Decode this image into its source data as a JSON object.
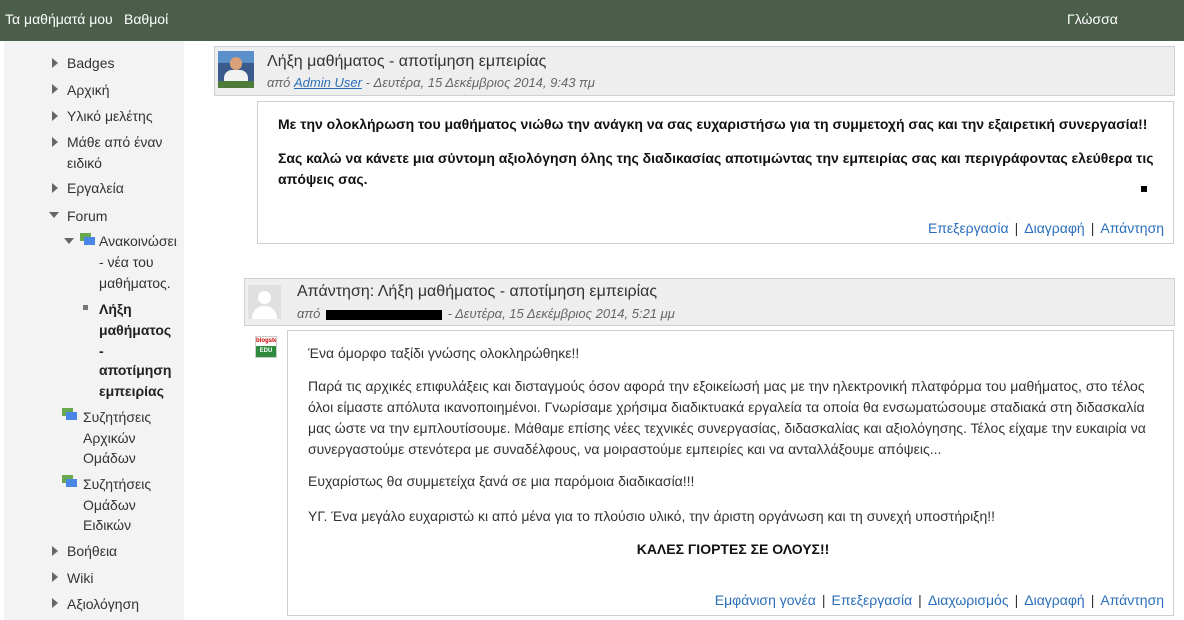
{
  "topbar": {
    "my_courses": "Τα μαθήματά μου",
    "grades": "Βαθμοί",
    "language": "Γλώσσα"
  },
  "sidebar": {
    "badges": "Badges",
    "home": "Αρχική",
    "material": "Υλικό μελέτης",
    "expert_line1": "Μάθε από έναν",
    "expert_line2": "ειδικό",
    "tools": "Εργαλεία",
    "forum": "Forum",
    "announcements_line1": "Ανακοινώσει",
    "announcements_line2": "- νέα του",
    "announcements_line3": "μαθήματος.",
    "current_line1": "Λήξη",
    "current_line2": "μαθήματος",
    "current_line3": "-",
    "current_line4": "αποτίμηση",
    "current_line5": "εμπειρίας",
    "initial_groups_line1": "Συζητήσεις",
    "initial_groups_line2": "Αρχικών",
    "initial_groups_line3": "Ομάδων",
    "special_groups_line1": "Συζητήσεις",
    "special_groups_line2": "Ομάδων",
    "special_groups_line3": "Ειδικών",
    "help": "Βοήθεια",
    "wiki": "Wiki",
    "evaluation": "Αξιολόγηση"
  },
  "post1": {
    "title": "Λήξη μαθήματος - αποτίμηση εμπειρίας",
    "by_prefix": "από",
    "author": "Admin User",
    "date": "- Δευτέρα, 15 Δεκέμβριος 2014, 9:43 πμ",
    "para1": "Με την ολοκλήρωση του μαθήματος νιώθω την ανάγκη να σας ευχαριστήσω για τη συμμετοχή σας και την εξαιρετική συνεργασία!!",
    "para2": "Σας καλώ να κάνετε μια σύντομη αξιολόγηση όλης της διαδικασίας αποτιμώντας την  εμπειρίας σας και περιγράφοντας ελεύθερα τις απόψεις σας.",
    "edit": "Επεξεργασία",
    "delete": "Διαγραφή",
    "reply": "Απάντηση"
  },
  "post2": {
    "title": "Απάντηση: Λήξη μαθήματος - αποτίμηση εμπειρίας",
    "by_prefix": "από",
    "date": "- Δευτέρα, 15 Δεκέμβριος 2014, 5:21 μμ",
    "logo_text_top": "blogste",
    "logo_text_bottom": "EDU",
    "para1": "Ένα όμορφο ταξίδι γνώσης ολοκληρώθηκε!!",
    "para2": "Παρά τις αρχικές επιφυλάξεις και δισταγμούς όσον αφορά την εξοικείωσή μας με την ηλεκτρονική πλατφόρμα του μαθήματος, στο τέλος όλοι είμαστε απόλυτα ικανοποιημένοι. Γνωρίσαμε χρήσιμα διαδικτυακά εργαλεία τα οποία θα ενσωματώσουμε σταδιακά στη διδασκαλία μας ώστε να την εμπλουτίσουμε. Μάθαμε επίσης νέες τεχνικές συνεργασίας, διδασκαλίας και αξιολόγησης. Τέλος είχαμε την ευκαιρία να συνεργαστούμε στενότερα με συναδέλφους, να μοιραστούμε εμπειρίες και να ανταλλάξουμε απόψεις...",
    "para3": "Ευχαρίστως θα συμμετείχα ξανά σε μια παρόμοια διαδικασία!!!",
    "para4": "ΥΓ. Ένα μεγάλο ευχαριστώ κι από μένα για το πλούσιο υλικό, την άριστη οργάνωση και τη συνεχή υποστήριξη!!",
    "para5": "ΚΑΛΕΣ ΓΙΟΡΤΕΣ ΣΕ ΟΛΟΥΣ!!",
    "show_parent": "Εμφάνιση γονέα",
    "edit": "Επεξεργασία",
    "split": "Διαχωρισμός",
    "delete": "Διαγραφή",
    "reply": "Απάντηση"
  }
}
